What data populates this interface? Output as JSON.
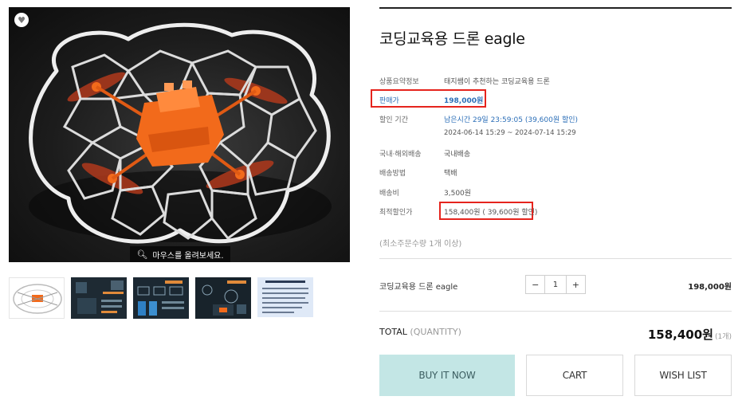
{
  "gallery": {
    "wish_icon": "heart-icon",
    "zoom_hint": "마우스를 올려보세요.",
    "zoom_icon": "magnifier-icon",
    "thumbnail_count": 5
  },
  "product": {
    "title": "코딩교육용 드론 eagle"
  },
  "info": {
    "summary_label": "상품요약정보",
    "summary_value": "태지쌤이 추천하는 코딩교육용 드론",
    "price_label": "판매가",
    "price_value": "198,000원",
    "discount_label": "할인 기간",
    "discount_remaining": "남은시간 29일 23:59:05 (39,600원 할인)",
    "discount_period": "2024-06-14 15:29 ~ 2024-07-14 15:29",
    "domestic_label": "국내·해외배송",
    "domestic_value": "국내배송",
    "method_label": "배송방법",
    "method_value": "택배",
    "fee_label": "배송비",
    "fee_value": "3,500원",
    "best_label": "최적할인가",
    "best_value": "158,400원 ( 39,600원 할인)",
    "min_order": "(최소주문수량 1개 이상)"
  },
  "option": {
    "item_name": "코딩교육용 드론 eagle",
    "minus": "−",
    "quantity": "1",
    "plus": "+",
    "item_price": "198,000원"
  },
  "total": {
    "label": "TOTAL",
    "sub": "(QUANTITY)",
    "price": "158,400원",
    "count": "(1개)"
  },
  "actions": {
    "buy": "BUY IT NOW",
    "cart": "CART",
    "wish": "WISH LIST"
  },
  "colors": {
    "accent_blue": "#2c6fb8",
    "highlight_red": "#e5241d",
    "buy_button": "#c3e6e5",
    "drone_orange": "#f26a1b"
  }
}
